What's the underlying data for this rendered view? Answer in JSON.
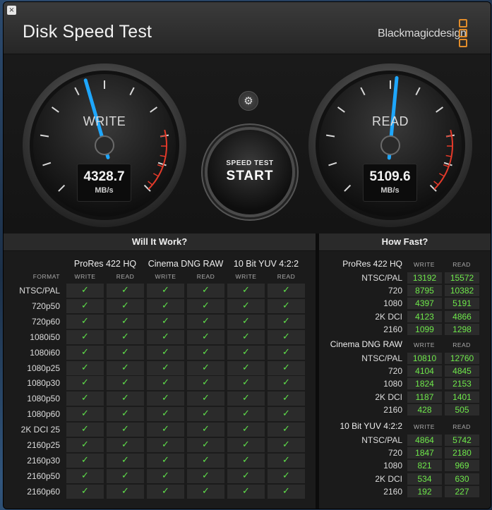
{
  "window": {
    "close_glyph": "×",
    "title": "Disk Speed Test",
    "brand": "Blackmagicdesign"
  },
  "gauges": {
    "write": {
      "label": "WRITE",
      "value": "4328.7",
      "unit": "MB/s",
      "needle_fraction": 0.44
    },
    "read": {
      "label": "READ",
      "value": "5109.6",
      "unit": "MB/s",
      "needle_fraction": 0.52
    }
  },
  "controls": {
    "settings_icon": "gear-icon",
    "settings_glyph": "⚙",
    "start_line1": "SPEED TEST",
    "start_line2": "START"
  },
  "colors": {
    "needle": "#1ea7ff",
    "check": "#5fe14a",
    "value_green": "#6ee84a",
    "redzone": "#e53a2a",
    "brand_accent": "#e38d2a"
  },
  "will": {
    "title": "Will It Work?",
    "format_caption": "FORMAT",
    "groups": [
      {
        "name": "ProRes 422 HQ",
        "cols": [
          "WRITE",
          "READ"
        ]
      },
      {
        "name": "Cinema DNG RAW",
        "cols": [
          "WRITE",
          "READ"
        ]
      },
      {
        "name": "10 Bit YUV 4:2:2",
        "cols": [
          "WRITE",
          "READ"
        ]
      }
    ],
    "check_glyph": "✓",
    "rows": [
      "NTSC/PAL",
      "720p50",
      "720p60",
      "1080i50",
      "1080i60",
      "1080p25",
      "1080p30",
      "1080p50",
      "1080p60",
      "2K DCI 25",
      "2160p25",
      "2160p30",
      "2160p50",
      "2160p60"
    ]
  },
  "how": {
    "title": "How Fast?",
    "groups": [
      {
        "name": "ProRes 422 HQ",
        "cols": [
          "WRITE",
          "READ"
        ],
        "rows": [
          {
            "label": "NTSC/PAL",
            "write": "13192",
            "read": "15572"
          },
          {
            "label": "720",
            "write": "8795",
            "read": "10382"
          },
          {
            "label": "1080",
            "write": "4397",
            "read": "5191"
          },
          {
            "label": "2K DCI",
            "write": "4123",
            "read": "4866"
          },
          {
            "label": "2160",
            "write": "1099",
            "read": "1298"
          }
        ]
      },
      {
        "name": "Cinema DNG RAW",
        "cols": [
          "WRITE",
          "READ"
        ],
        "rows": [
          {
            "label": "NTSC/PAL",
            "write": "10810",
            "read": "12760"
          },
          {
            "label": "720",
            "write": "4104",
            "read": "4845"
          },
          {
            "label": "1080",
            "write": "1824",
            "read": "2153"
          },
          {
            "label": "2K DCI",
            "write": "1187",
            "read": "1401"
          },
          {
            "label": "2160",
            "write": "428",
            "read": "505"
          }
        ]
      },
      {
        "name": "10 Bit YUV 4:2:2",
        "cols": [
          "WRITE",
          "READ"
        ],
        "rows": [
          {
            "label": "NTSC/PAL",
            "write": "4864",
            "read": "5742"
          },
          {
            "label": "720",
            "write": "1847",
            "read": "2180"
          },
          {
            "label": "1080",
            "write": "821",
            "read": "969"
          },
          {
            "label": "2K DCI",
            "write": "534",
            "read": "630"
          },
          {
            "label": "2160",
            "write": "192",
            "read": "227"
          }
        ]
      }
    ]
  }
}
